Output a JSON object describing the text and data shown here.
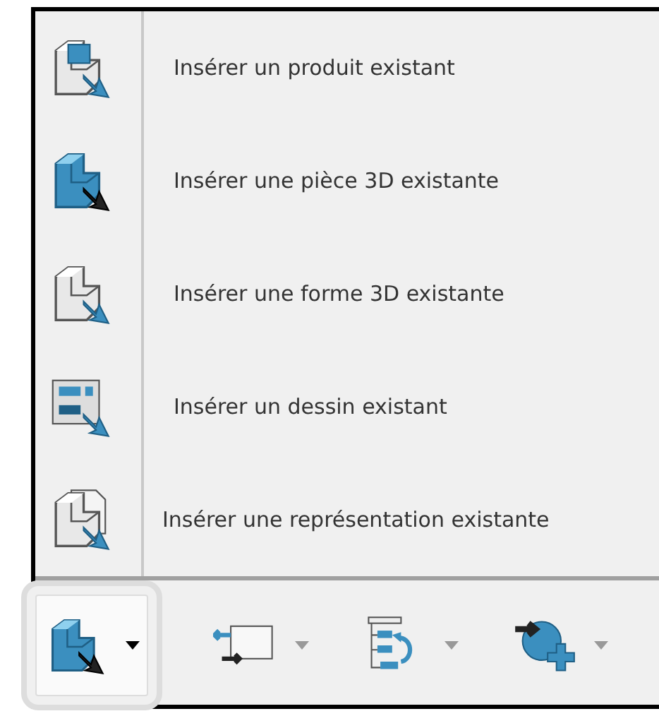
{
  "menu": {
    "items": [
      {
        "label": "Insérer un produit existant"
      },
      {
        "label": "Insérer une pièce 3D existante"
      },
      {
        "label": "Insérer une forme 3D existante"
      },
      {
        "label": "Insérer un dessin existant"
      },
      {
        "label": "Insérer une représentation existante"
      }
    ]
  },
  "toolbar": {
    "buttons": [
      {
        "selected": true,
        "highlighted": true
      },
      {
        "selected": false,
        "highlighted": false
      },
      {
        "selected": false,
        "highlighted": false
      },
      {
        "selected": false,
        "highlighted": false
      }
    ]
  }
}
